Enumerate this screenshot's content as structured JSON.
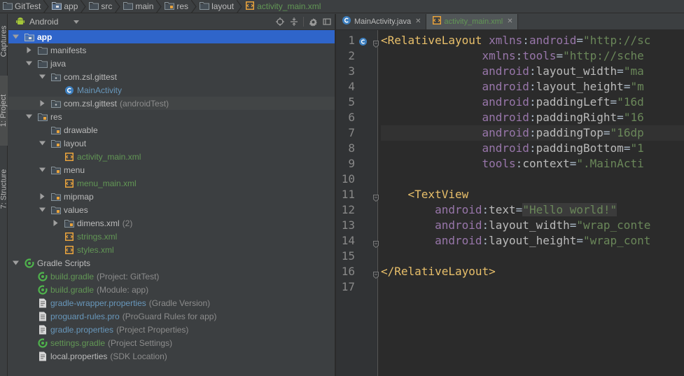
{
  "breadcrumbs": [
    {
      "label": "GitTest",
      "icon": "folder-icon"
    },
    {
      "label": "app",
      "icon": "module-folder-icon"
    },
    {
      "label": "src",
      "icon": "folder-icon"
    },
    {
      "label": "main",
      "icon": "folder-icon"
    },
    {
      "label": "res",
      "icon": "res-folder-icon"
    },
    {
      "label": "layout",
      "icon": "folder-icon"
    },
    {
      "label": "activity_main.xml",
      "icon": "xml-file-icon"
    }
  ],
  "side_tabs": {
    "captures": "Captures",
    "project": "1: Project",
    "structure": "7: Structure"
  },
  "project_panel": {
    "view_mode": "Android"
  },
  "tree": [
    {
      "label": "app",
      "hint": "",
      "depth": 0,
      "expanded": true,
      "icon": "module-icon",
      "style": "selected"
    },
    {
      "label": "manifests",
      "hint": "",
      "depth": 1,
      "expanded": false,
      "icon": "folder-icon"
    },
    {
      "label": "java",
      "hint": "",
      "depth": 1,
      "expanded": true,
      "icon": "folder-icon"
    },
    {
      "label": "com.zsl.gittest",
      "hint": "",
      "depth": 2,
      "expanded": true,
      "icon": "package-icon"
    },
    {
      "label": "MainActivity",
      "hint": "",
      "depth": 3,
      "leaf": true,
      "icon": "class-icon",
      "style": "mod"
    },
    {
      "label": "com.zsl.gittest",
      "hint": "(androidTest)",
      "depth": 2,
      "expanded": false,
      "icon": "package-icon",
      "row": "highlight"
    },
    {
      "label": "res",
      "hint": "",
      "depth": 1,
      "expanded": true,
      "icon": "res-folder-icon"
    },
    {
      "label": "drawable",
      "hint": "",
      "depth": 2,
      "leaf": true,
      "icon": "res-folder-icon"
    },
    {
      "label": "layout",
      "hint": "",
      "depth": 2,
      "expanded": true,
      "icon": "res-folder-icon"
    },
    {
      "label": "activity_main.xml",
      "hint": "",
      "depth": 3,
      "leaf": true,
      "icon": "xml-file-icon",
      "style": "green"
    },
    {
      "label": "menu",
      "hint": "",
      "depth": 2,
      "expanded": true,
      "icon": "res-folder-icon"
    },
    {
      "label": "menu_main.xml",
      "hint": "",
      "depth": 3,
      "leaf": true,
      "icon": "xml-file-icon",
      "style": "green"
    },
    {
      "label": "mipmap",
      "hint": "",
      "depth": 2,
      "expanded": false,
      "icon": "res-folder-icon"
    },
    {
      "label": "values",
      "hint": "",
      "depth": 2,
      "expanded": true,
      "icon": "res-folder-icon"
    },
    {
      "label": "dimens.xml",
      "hint": "(2)",
      "depth": 3,
      "expanded": false,
      "icon": "res-folder-icon"
    },
    {
      "label": "strings.xml",
      "hint": "",
      "depth": 3,
      "leaf": true,
      "icon": "xml-file-icon",
      "style": "green"
    },
    {
      "label": "styles.xml",
      "hint": "",
      "depth": 3,
      "leaf": true,
      "icon": "xml-file-icon",
      "style": "green"
    },
    {
      "label": "Gradle Scripts",
      "hint": "",
      "depth": 0,
      "expanded": true,
      "icon": "gradle-icon"
    },
    {
      "label": "build.gradle",
      "hint": "(Project: GitTest)",
      "depth": 1,
      "leaf": true,
      "icon": "gradle-icon",
      "style": "green"
    },
    {
      "label": "build.gradle",
      "hint": "(Module: app)",
      "depth": 1,
      "leaf": true,
      "icon": "gradle-icon",
      "style": "green"
    },
    {
      "label": "gradle-wrapper.properties",
      "hint": "(Gradle Version)",
      "depth": 1,
      "leaf": true,
      "icon": "properties-file-icon",
      "style": "mod"
    },
    {
      "label": "proguard-rules.pro",
      "hint": "(ProGuard Rules for app)",
      "depth": 1,
      "leaf": true,
      "icon": "text-file-icon",
      "style": "mod"
    },
    {
      "label": "gradle.properties",
      "hint": "(Project Properties)",
      "depth": 1,
      "leaf": true,
      "icon": "properties-file-icon",
      "style": "mod"
    },
    {
      "label": "settings.gradle",
      "hint": "(Project Settings)",
      "depth": 1,
      "leaf": true,
      "icon": "gradle-icon",
      "style": "green"
    },
    {
      "label": "local.properties",
      "hint": "(SDK Location)",
      "depth": 1,
      "leaf": true,
      "icon": "properties-file-icon"
    }
  ],
  "editor_tabs": [
    {
      "label": "MainActivity.java",
      "icon": "class-icon",
      "active": false
    },
    {
      "label": "activity_main.xml",
      "icon": "xml-file-icon",
      "active": true
    }
  ],
  "code": {
    "current_line": 7,
    "lines": [
      [
        [
          "t-tag",
          "<RelativeLayout "
        ],
        [
          "t-ns",
          "xmlns"
        ],
        [
          "t-punc",
          ":"
        ],
        [
          "t-ns",
          "android"
        ],
        [
          "t-punc",
          "="
        ],
        [
          "t-val",
          "\"http://sc"
        ]
      ],
      [
        [
          "t-punc",
          "               "
        ],
        [
          "t-ns",
          "xmlns"
        ],
        [
          "t-punc",
          ":"
        ],
        [
          "t-ns",
          "tools"
        ],
        [
          "t-punc",
          "="
        ],
        [
          "t-val",
          "\"http://sche"
        ]
      ],
      [
        [
          "t-punc",
          "               "
        ],
        [
          "t-ns",
          "android"
        ],
        [
          "t-punc",
          ":"
        ],
        [
          "t-attr",
          "layout_width"
        ],
        [
          "t-punc",
          "="
        ],
        [
          "t-val",
          "\"ma"
        ]
      ],
      [
        [
          "t-punc",
          "               "
        ],
        [
          "t-ns",
          "android"
        ],
        [
          "t-punc",
          ":"
        ],
        [
          "t-attr",
          "layout_height"
        ],
        [
          "t-punc",
          "="
        ],
        [
          "t-val",
          "\"m"
        ]
      ],
      [
        [
          "t-punc",
          "               "
        ],
        [
          "t-ns",
          "android"
        ],
        [
          "t-punc",
          ":"
        ],
        [
          "t-attr",
          "paddingLeft"
        ],
        [
          "t-punc",
          "="
        ],
        [
          "t-val",
          "\"16d"
        ]
      ],
      [
        [
          "t-punc",
          "               "
        ],
        [
          "t-ns",
          "android"
        ],
        [
          "t-punc",
          ":"
        ],
        [
          "t-attr",
          "paddingRight"
        ],
        [
          "t-punc",
          "="
        ],
        [
          "t-val",
          "\"16"
        ]
      ],
      [
        [
          "t-punc",
          "               "
        ],
        [
          "t-ns",
          "android"
        ],
        [
          "t-punc",
          ":"
        ],
        [
          "t-attr",
          "paddingTop"
        ],
        [
          "t-punc",
          "="
        ],
        [
          "t-val",
          "\"16dp"
        ]
      ],
      [
        [
          "t-punc",
          "               "
        ],
        [
          "t-ns",
          "android"
        ],
        [
          "t-punc",
          ":"
        ],
        [
          "t-attr",
          "paddingBottom"
        ],
        [
          "t-punc",
          "="
        ],
        [
          "t-val",
          "\"1"
        ]
      ],
      [
        [
          "t-punc",
          "               "
        ],
        [
          "t-ns",
          "tools"
        ],
        [
          "t-punc",
          ":"
        ],
        [
          "t-attr",
          "context"
        ],
        [
          "t-punc",
          "="
        ],
        [
          "t-val",
          "\".MainActi"
        ]
      ],
      [],
      [
        [
          "t-punc",
          "    "
        ],
        [
          "t-tag",
          "<TextView"
        ]
      ],
      [
        [
          "t-punc",
          "        "
        ],
        [
          "t-ns",
          "android"
        ],
        [
          "t-punc",
          ":"
        ],
        [
          "t-attr",
          "text"
        ],
        [
          "t-punc",
          "="
        ],
        [
          "t-val t-hl",
          "\"Hello world!\""
        ]
      ],
      [
        [
          "t-punc",
          "        "
        ],
        [
          "t-ns",
          "android"
        ],
        [
          "t-punc",
          ":"
        ],
        [
          "t-attr",
          "layout_width"
        ],
        [
          "t-punc",
          "="
        ],
        [
          "t-val",
          "\"wrap_conte"
        ]
      ],
      [
        [
          "t-punc",
          "        "
        ],
        [
          "t-ns",
          "android"
        ],
        [
          "t-punc",
          ":"
        ],
        [
          "t-attr",
          "layout_height"
        ],
        [
          "t-punc",
          "="
        ],
        [
          "t-val",
          "\"wrap_cont"
        ]
      ],
      [],
      [
        [
          "t-tag",
          "</RelativeLayout>"
        ]
      ],
      []
    ]
  },
  "colors": {
    "accent_selection": "#2f65ca",
    "xml_green": "#629755",
    "modified_blue": "#6897bb",
    "tag_yellow": "#e8bf6a",
    "namespace_purple": "#9876aa"
  }
}
